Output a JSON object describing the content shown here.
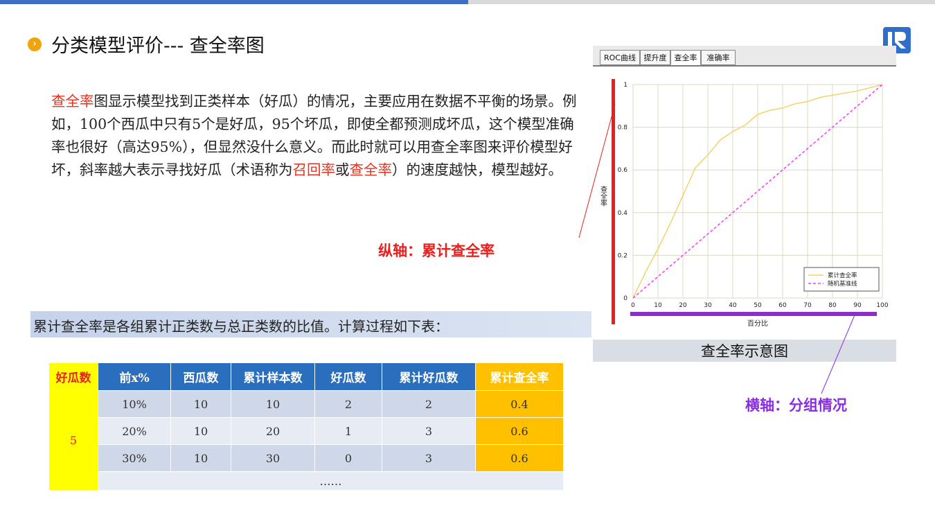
{
  "header": {
    "title": "分类模型评价--- 查全率图"
  },
  "paragraph": {
    "p1": "查全率",
    "p2": "图显示模型找到正类样本（好瓜）的情况，主要应用在数据不平衡的场景。例如，100个西瓜中只有5个是好瓜，95个坏瓜，即使全都预测成坏瓜，这个模型准确率也很好（高达95%），但显然没什么意义。而此时就可以用查全率图来评价模型好坏，斜率越大表示寻找好瓜（术语称为",
    "p3": "召回率",
    "p4": "或",
    "p5": "查全率",
    "p6": "）的速度越快，模型越好。"
  },
  "annotations": {
    "y_axis": "纵轴：累计查全率",
    "x_axis": "横轴：分组情况"
  },
  "summary": "累计查全率是各组累计正类数与总正类数的比值。计算过程如下表：",
  "table": {
    "headers": [
      "好瓜数",
      "前x%",
      "西瓜数",
      "累计样本数",
      "好瓜数",
      "累计好瓜数",
      "累计查全率"
    ],
    "group_value": "5",
    "rows": [
      [
        "10%",
        "10",
        "10",
        "2",
        "2",
        "0.4"
      ],
      [
        "20%",
        "10",
        "20",
        "1",
        "3",
        "0.6"
      ],
      [
        "30%",
        "10",
        "30",
        "0",
        "3",
        "0.6"
      ]
    ],
    "ellipsis": "……"
  },
  "chart_tabs": [
    "ROC曲线",
    "提升度",
    "查全率",
    "准确率"
  ],
  "chart_tab_active": 2,
  "chart_caption": "查全率示意图",
  "colors": {
    "accent_blue": "#3a6fc4",
    "title_bullet": "#f0a30a",
    "red_text": "#e8321e",
    "purple": "#8a2be2",
    "header_blue": "#2a6ebe",
    "yellow": "#ffff00",
    "orange": "#ffc000",
    "curve": "#f5d26a",
    "baseline": "#ff33ff"
  },
  "chart_data": {
    "type": "line",
    "xlabel": "百分比",
    "ylabel": "查全率",
    "xlim": [
      0,
      100
    ],
    "ylim": [
      0,
      1
    ],
    "xticks": [
      0,
      10,
      20,
      30,
      40,
      50,
      60,
      70,
      80,
      90,
      100
    ],
    "yticks": [
      0,
      0.2,
      0.4,
      0.6,
      0.8,
      1
    ],
    "grid": true,
    "legend_position": "bottom-right",
    "series": [
      {
        "name": "累计查全率",
        "x": [
          0,
          5,
          10,
          15,
          20,
          25,
          30,
          35,
          40,
          45,
          50,
          55,
          60,
          65,
          70,
          75,
          80,
          85,
          90,
          95,
          100
        ],
        "y": [
          0,
          0.12,
          0.23,
          0.35,
          0.48,
          0.61,
          0.67,
          0.74,
          0.78,
          0.81,
          0.86,
          0.88,
          0.89,
          0.91,
          0.92,
          0.94,
          0.95,
          0.96,
          0.97,
          0.985,
          1.0
        ]
      },
      {
        "name": "随机基准线",
        "x": [
          0,
          100
        ],
        "y": [
          0,
          1
        ]
      }
    ]
  }
}
